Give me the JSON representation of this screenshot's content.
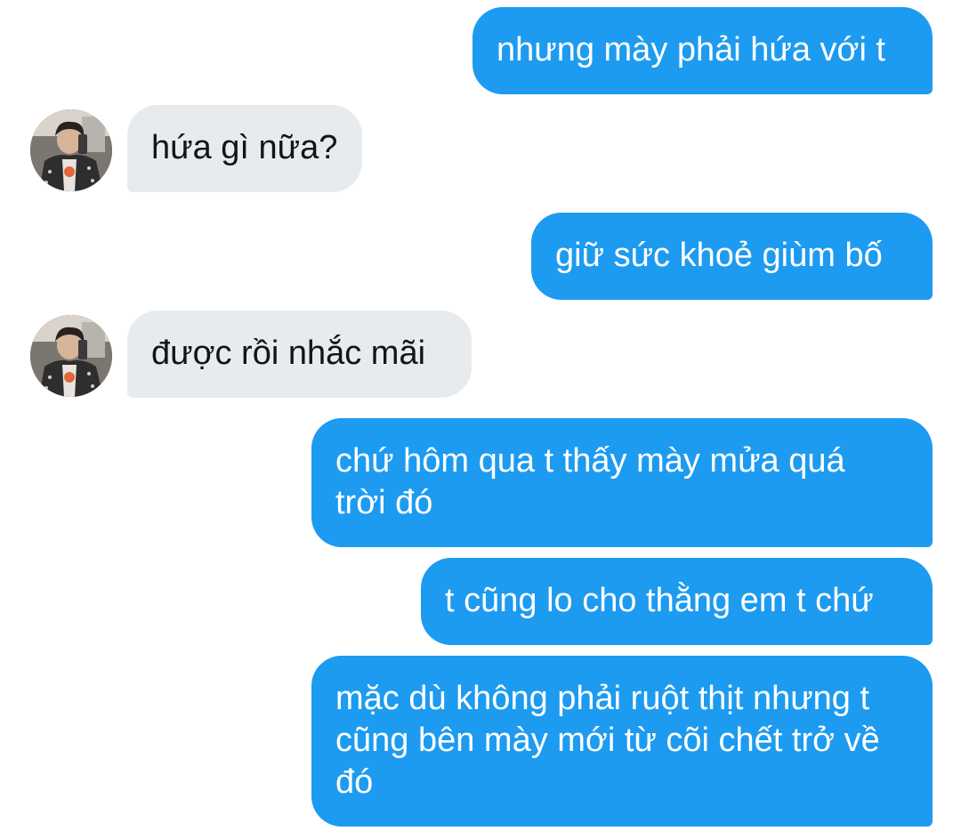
{
  "conversation": {
    "messages": [
      {
        "sender": "me",
        "text": "nhưng mày phải hứa với t"
      },
      {
        "sender": "them",
        "text": "hứa gì nữa?"
      },
      {
        "sender": "me",
        "text": "giữ sức khoẻ giùm bố"
      },
      {
        "sender": "them",
        "text": "được rồi nhắc mãi"
      },
      {
        "sender": "me",
        "text": "chứ hôm qua t thấy mày mửa quá\ntrời đó"
      },
      {
        "sender": "me",
        "text": "t cũng lo cho thằng em t chứ"
      },
      {
        "sender": "me",
        "text": "mặc dù không phải ruột thịt nhưng t\ncũng bên mày mới từ cõi chết trở về\nđó"
      }
    ]
  },
  "colors": {
    "outgoing_bubble": "#1d9bf0",
    "incoming_bubble": "#e8ebed",
    "outgoing_text": "#ffffff",
    "incoming_text": "#141414"
  }
}
